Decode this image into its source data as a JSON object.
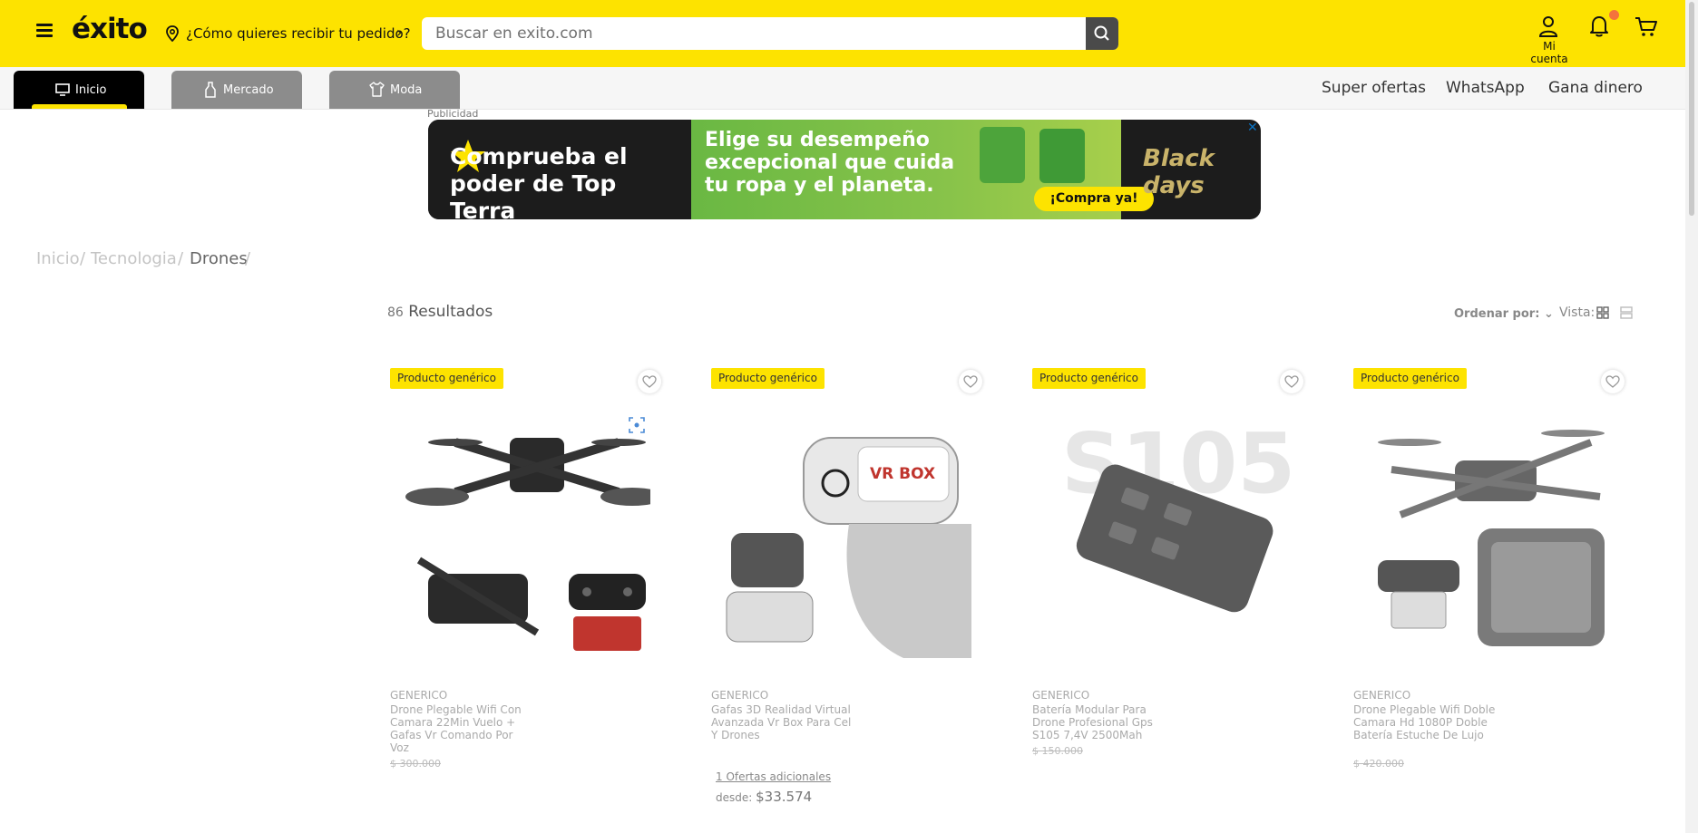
{
  "header": {
    "logo": "éxito",
    "location_prompt": "¿Cómo quieres recibir tu pedido?",
    "search_placeholder": "Buscar en exito.com",
    "account_label": "Mi cuenta"
  },
  "nav": {
    "tabs": [
      {
        "label": "Inicio",
        "icon": "monitor-icon"
      },
      {
        "label": "Mercado",
        "icon": "bottle-icon"
      },
      {
        "label": "Moda",
        "icon": "shirt-icon"
      }
    ],
    "links": [
      "Super ofertas",
      "WhatsApp",
      "Gana dinero"
    ]
  },
  "ad": {
    "label": "Publicidad",
    "left_text": "Comprueba el poder de Top Terra",
    "mid_text": "Elige su desempeño excepcional que cuida tu ropa y el planeta.",
    "cta": "¡Compra ya!",
    "right_text": "Black days",
    "close": "✕"
  },
  "breadcrumb": [
    "Inicio",
    "Tecnologia",
    "Drones"
  ],
  "results": {
    "count": "86",
    "label": "Resultados",
    "sort_label": "Ordenar por:",
    "view_label": "Vista:"
  },
  "products": [
    {
      "badge": "Producto genérico",
      "brand": "GENERICO",
      "name": "Drone Plegable Wifi Con Camara 22Min Vuelo + Gafas Vr Comando Por Voz",
      "old_price": "$ 300.000"
    },
    {
      "badge": "Producto genérico",
      "brand": "GENERICO",
      "name": "Gafas 3D Realidad Virtual Avanzada Vr Box Para Cel Y Drones",
      "offers": "1 Ofertas adicionales",
      "from_label": "desde:",
      "from_price": "$33.574",
      "image_text": "VR BOX"
    },
    {
      "badge": "Producto genérico",
      "brand": "GENERICO",
      "name": "Batería Modular Para Drone Profesional Gps S105 7,4V 2500Mah",
      "old_price": "$ 150.000",
      "image_text": "S105"
    },
    {
      "badge": "Producto genérico",
      "brand": "GENERICO",
      "name": "Drone Plegable Wifi Doble Camara Hd 1080P Doble Batería Estuche De Lujo",
      "old_price": "$ 420.000"
    }
  ]
}
